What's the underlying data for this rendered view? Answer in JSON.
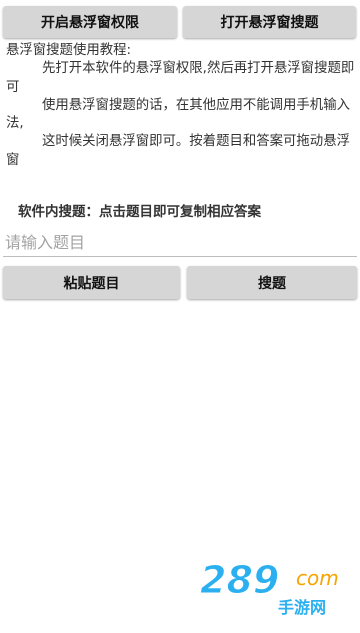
{
  "buttons": {
    "floating_permission": "开启悬浮窗权限",
    "open_floating_search": "打开悬浮窗搜题",
    "paste_question": "粘贴题目",
    "search_question": "搜题"
  },
  "tutorial": {
    "title": "悬浮窗搜题使用教程:",
    "step1": "先打开本软件的悬浮窗权限,然后再打开悬浮窗搜题即可",
    "step2": "使用悬浮窗搜题的话，在其他应用不能调用手机输入法,",
    "step3": "这时候关闭悬浮窗即可。按着题目和答案可拖动悬浮窗"
  },
  "hint": "软件内搜题：点击题目即可复制相应答案",
  "search": {
    "placeholder": "请输入题目"
  },
  "watermark": {
    "logo": "289",
    "suffix": "com",
    "cn": "手游网"
  },
  "colors": {
    "button_bg": "#d6d6d6",
    "watermark_blue": "#2ab0f0",
    "watermark_orange": "#f6a400"
  }
}
